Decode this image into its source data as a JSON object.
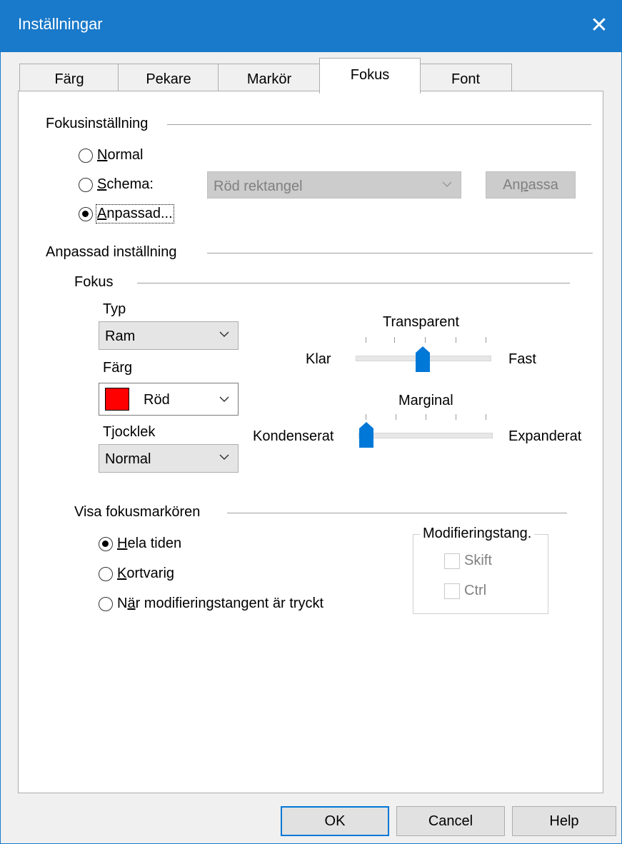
{
  "window": {
    "title": "Inställningar",
    "close_glyph": "✕"
  },
  "tabs": [
    {
      "label": "Färg"
    },
    {
      "label": "Pekare"
    },
    {
      "label": "Markör"
    },
    {
      "label": "Fokus"
    },
    {
      "label": "Font"
    }
  ],
  "active_tab": "Fokus",
  "focus_setting": {
    "heading": "Fokusinställning",
    "normal": {
      "mnemonic": "N",
      "rest": "ormal"
    },
    "schema": {
      "mnemonic": "S",
      "rest": "chema:"
    },
    "anpassad": {
      "mnemonic": "A",
      "rest": "npassad..."
    },
    "schema_value": "Röd rektangel",
    "customize_button": {
      "pre": "An",
      "mnemonic": "p",
      "post": "assa"
    },
    "selected": "anpassad"
  },
  "custom_setting": {
    "heading": "Anpassad inställning",
    "focus_heading": "Fokus",
    "type_label": "Typ",
    "type_value": "Ram",
    "color_label": "Färg",
    "color_value": "Röd",
    "color_swatch": "#ff0000",
    "thickness_label": "Tjocklek",
    "thickness_value": "Normal",
    "transparent": {
      "title": "Transparent",
      "left": "Klar",
      "right": "Fast",
      "level": 0.5
    },
    "margin": {
      "title": "Marginal",
      "left": "Kondenserat",
      "right": "Expanderat",
      "level": 0.0
    }
  },
  "show_cursor": {
    "heading": "Visa fokusmarkören",
    "always": {
      "mnemonic": "H",
      "rest": "ela tiden"
    },
    "brief": {
      "mnemonic": "K",
      "rest": "ortvarig"
    },
    "modifier": {
      "pre": "N",
      "mnemonic": "ä",
      "rest": "r modifieringstangent är tryckt"
    },
    "selected": "always",
    "modifier_group": {
      "title": "Modifieringstang.",
      "shift": "Skift",
      "ctrl": "Ctrl"
    }
  },
  "buttons": {
    "ok": "OK",
    "cancel": "Cancel",
    "help": "Help"
  },
  "colors": {
    "titlebar": "#1979ca",
    "accent": "#0078d7"
  }
}
